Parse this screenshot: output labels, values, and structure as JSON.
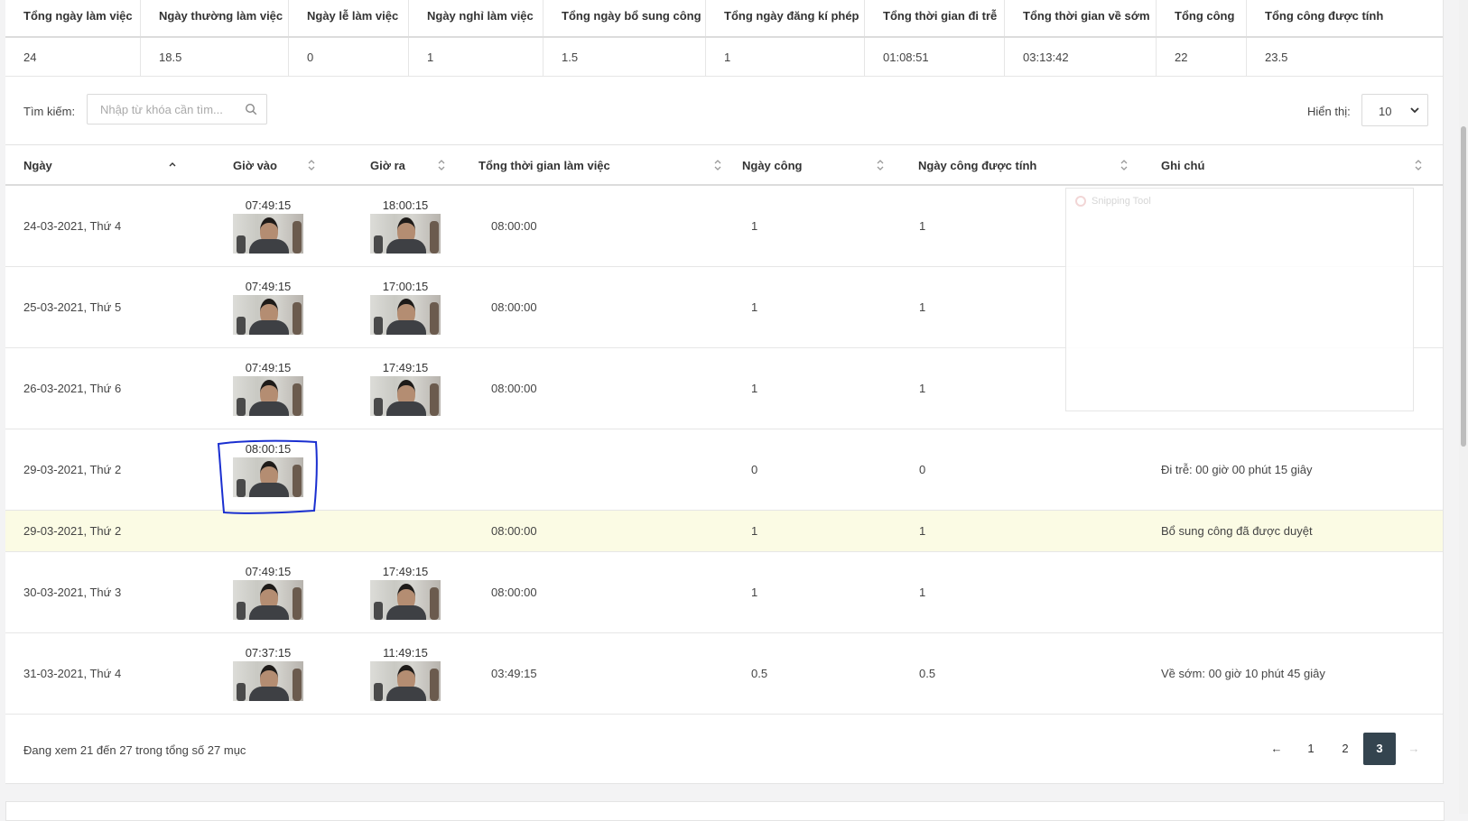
{
  "summary": {
    "headers": [
      "Tổng ngày làm việc",
      "Ngày thường làm việc",
      "Ngày lễ làm việc",
      "Ngày nghỉ làm việc",
      "Tổng ngày bổ sung công",
      "Tổng ngày đăng kí phép",
      "Tổng thời gian đi trễ",
      "Tổng thời gian về sớm",
      "Tổng công",
      "Tổng công được tính"
    ],
    "values": [
      "24",
      "18.5",
      "0",
      "1",
      "1.5",
      "1",
      "01:08:51",
      "03:13:42",
      "22",
      "23.5"
    ]
  },
  "search": {
    "label": "Tìm kiếm:",
    "placeholder": "Nhập từ khóa cần tìm..."
  },
  "display": {
    "label": "Hiển thị:",
    "value": "10"
  },
  "table": {
    "headers": [
      "Ngày",
      "Giờ vào",
      "Giờ ra",
      "Tổng thời gian làm việc",
      "Ngày công",
      "Ngày công được tính",
      "Ghi chú"
    ],
    "rows": [
      {
        "date": "24-03-2021, Thứ 4",
        "in": "07:49:15",
        "out": "18:00:15",
        "total": "08:00:00",
        "work": "1",
        "counted": "1",
        "note": ""
      },
      {
        "date": "25-03-2021, Thứ 5",
        "in": "07:49:15",
        "out": "17:00:15",
        "total": "08:00:00",
        "work": "1",
        "counted": "1",
        "note": ""
      },
      {
        "date": "26-03-2021, Thứ 6",
        "in": "07:49:15",
        "out": "17:49:15",
        "total": "08:00:00",
        "work": "1",
        "counted": "1",
        "note": ""
      },
      {
        "date": "29-03-2021, Thứ 2",
        "in": "08:00:15",
        "out": "",
        "total": "",
        "work": "0",
        "counted": "0",
        "note": "Đi trễ: 00 giờ 00 phút 15 giây"
      },
      {
        "date": "29-03-2021, Thứ 2",
        "in": "",
        "out": "",
        "total": "08:00:00",
        "work": "1",
        "counted": "1",
        "note": "Bổ sung công đã được duyệt"
      },
      {
        "date": "30-03-2021, Thứ 3",
        "in": "07:49:15",
        "out": "17:49:15",
        "total": "08:00:00",
        "work": "1",
        "counted": "1",
        "note": ""
      },
      {
        "date": "31-03-2021, Thứ 4",
        "in": "07:37:15",
        "out": "11:49:15",
        "total": "03:49:15",
        "work": "0.5",
        "counted": "0.5",
        "note": "Về sớm: 00 giờ 10 phút 45 giây"
      }
    ]
  },
  "snipping": {
    "label": "Snipping Tool"
  },
  "footer": {
    "info": "Đang xem 21 đến 27 trong tổng số 27 mục",
    "prev": "←",
    "pages": [
      "1",
      "2",
      "3"
    ],
    "active_page": "3",
    "next": "→"
  },
  "colors": {
    "active_page": "#34444f",
    "highlight_row": "#fbfbe4",
    "annotation": "#1a2fd0"
  }
}
